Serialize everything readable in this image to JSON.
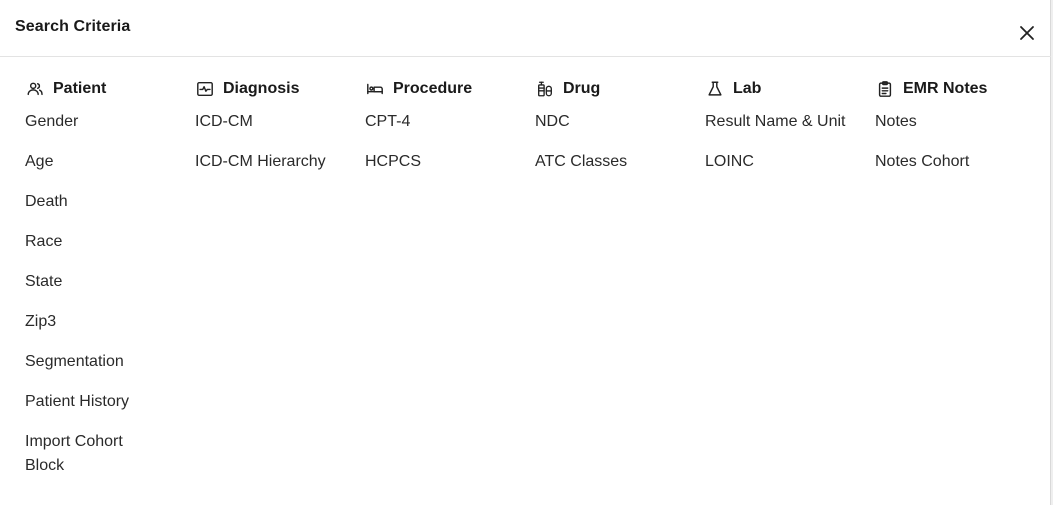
{
  "dialog": {
    "title": "Search Criteria"
  },
  "columns": [
    {
      "id": "patient",
      "label": "Patient",
      "icon": "users-icon",
      "items": [
        "Gender",
        "Age",
        "Death",
        "Race",
        "State",
        "Zip3",
        "Segmentation",
        "Patient History",
        "Import Cohort Block"
      ]
    },
    {
      "id": "diagnosis",
      "label": "Diagnosis",
      "icon": "activity-monitor-icon",
      "items": [
        "ICD-CM",
        "ICD-CM Hierarchy"
      ]
    },
    {
      "id": "procedure",
      "label": "Procedure",
      "icon": "bed-icon",
      "items": [
        "CPT-4",
        "HCPCS"
      ]
    },
    {
      "id": "drug",
      "label": "Drug",
      "icon": "pill-bottle-icon",
      "items": [
        "NDC",
        "ATC Classes"
      ]
    },
    {
      "id": "lab",
      "label": "Lab",
      "icon": "flask-icon",
      "items": [
        "Result Name & Unit",
        "LOINC"
      ]
    },
    {
      "id": "emr-notes",
      "label": "EMR Notes",
      "icon": "clipboard-icon",
      "items": [
        "Notes",
        "Notes Cohort"
      ]
    }
  ]
}
